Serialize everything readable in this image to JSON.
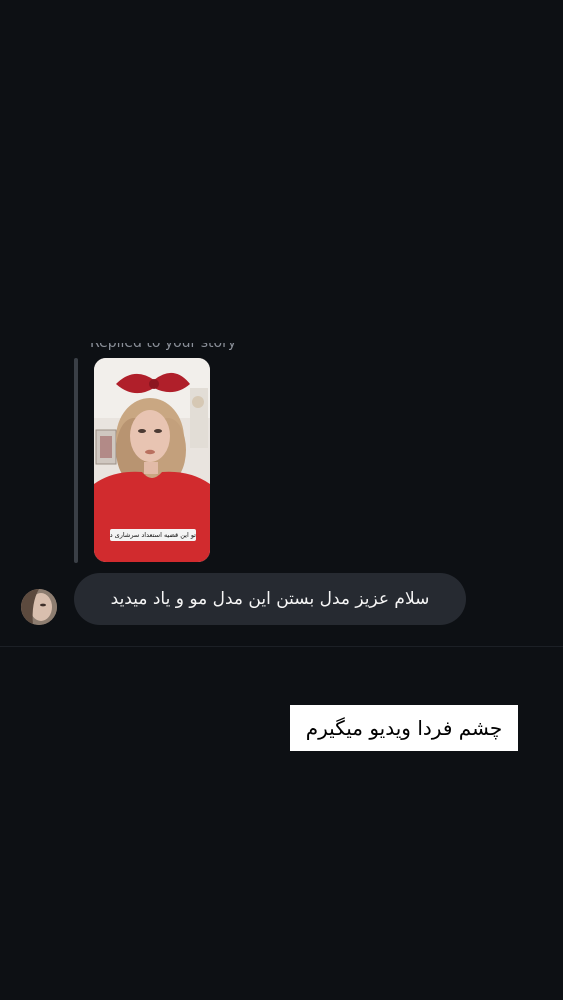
{
  "thread": {
    "replied_label": "Replied to your story",
    "story": {
      "caption": "تو این قضیه استعداد سرشاری دارم😋"
    },
    "incoming_message": {
      "text": "سلام عزیز مدل بستن این مدل مو و یاد میدید"
    },
    "outgoing_reply": {
      "text": "چشم فردا ویدیو میگیرم"
    }
  },
  "colors": {
    "background": "#0d1014",
    "bubble": "#262a31",
    "reply_bar": "#3a3f46",
    "story_shirt": "#d12b2e",
    "story_bow": "#b01f2a"
  }
}
